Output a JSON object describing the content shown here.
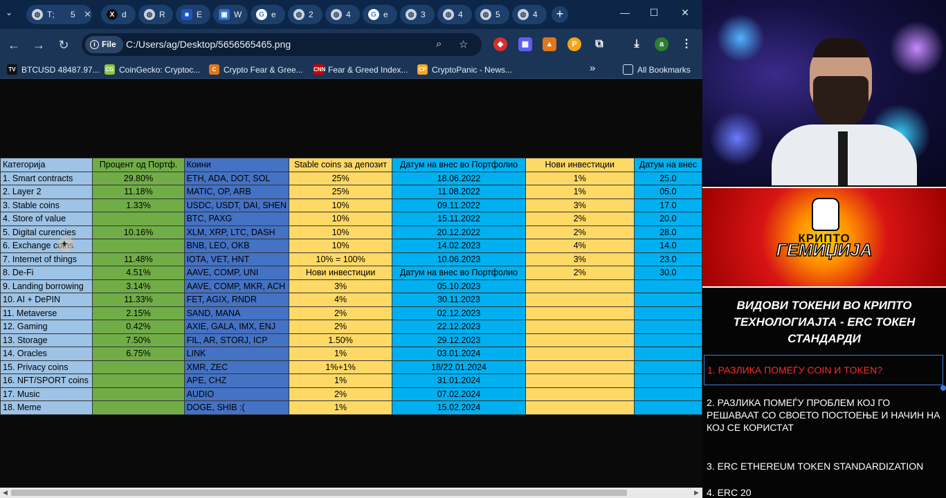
{
  "tabs": [
    {
      "icon": "globe",
      "label": "Т;"
    },
    {
      "icon": "none",
      "label": "5"
    },
    {
      "icon": "x",
      "label": "d"
    },
    {
      "icon": "globe",
      "label": "R"
    },
    {
      "icon": "cube",
      "label": "E"
    },
    {
      "icon": "box",
      "label": "W"
    },
    {
      "icon": "google",
      "label": "e"
    },
    {
      "icon": "globe",
      "label": "2"
    },
    {
      "icon": "globe",
      "label": "4"
    },
    {
      "icon": "google",
      "label": "e"
    },
    {
      "icon": "globe",
      "label": "3"
    },
    {
      "icon": "globe",
      "label": "4"
    },
    {
      "icon": "globe",
      "label": "5"
    },
    {
      "icon": "globe",
      "label": "4"
    }
  ],
  "newtab_label": "+",
  "window_controls": {
    "minimize": "—",
    "maximize": "☐",
    "close": "✕"
  },
  "nav": {
    "back": "←",
    "forward": "→",
    "reload": "↻"
  },
  "address": {
    "chip_label": "File",
    "url": "C:/Users/ag/Desktop/5656565465.png"
  },
  "bookmarks": [
    {
      "label": "BTCUSD 48487.97...",
      "icon_color": "#111111",
      "icon_text": "TV"
    },
    {
      "label": "CoinGecko: Cryptoc...",
      "icon_color": "#8dc63f",
      "icon_text": "CG"
    },
    {
      "label": "Crypto Fear & Gree...",
      "icon_color": "#e2761b",
      "icon_text": "C"
    },
    {
      "label": "Fear & Greed Index...",
      "icon_color": "#cc0000",
      "icon_text": "CNN"
    },
    {
      "label": "CryptoPanic - News...",
      "icon_color": "#f5a623",
      "icon_text": "CP"
    }
  ],
  "bookmarks_overflow": "»",
  "all_bookmarks": "All Bookmarks",
  "sheet": {
    "headers": [
      "Категорија",
      "Процент од Портф.",
      "Коини",
      "Stable coins за депозит",
      "Датум на внес во Портфолио",
      "Нови инвестиции",
      "Датум на внес"
    ],
    "rows": [
      [
        "1. Smart contracts",
        "29.80%",
        "ETH, ADA, DOT, SOL",
        "25%",
        "18.06.2022",
        "1%",
        "25.0"
      ],
      [
        "2. Layer 2",
        "11.18%",
        "MATIC, OP, ARB",
        "25%",
        "11.08.2022",
        "1%",
        "05.0"
      ],
      [
        "3. Stable coins",
        "1.33%",
        "USDC, USDT, DAI, SHEN",
        "10%",
        "09.11.2022",
        "3%",
        "17.0"
      ],
      [
        "4. Store of value",
        "",
        "BTC, PAXG",
        "10%",
        "15.11.2022",
        "2%",
        "20.0"
      ],
      [
        "5. Digital curencies",
        "10.16%",
        "XLM, XRP, LTC, DASH",
        "10%",
        "20.12.2022",
        "2%",
        "28.0"
      ],
      [
        "6. Exchange coins",
        "",
        "BNB, LEO, OKB",
        "10%",
        "14.02.2023",
        "4%",
        "14.0"
      ],
      [
        "7. Internet of things",
        "11.48%",
        "IOTA, VET, HNT",
        "10% = 100%",
        "10.06.2023",
        "3%",
        "23.0"
      ],
      [
        "8. De-Fi",
        "4.51%",
        "AAVE, COMP, UNI",
        "Нови инвестиции",
        "Датум на внес во Портфолио",
        "2%",
        "30.0"
      ],
      [
        "9. Landing borrowing",
        "3.14%",
        "AAVE, COMP, MKR, ACH",
        "3%",
        "05.10.2023",
        "",
        ""
      ],
      [
        "10. AI + DePIN",
        "11.33%",
        "FET, AGIX, RNDR",
        "4%",
        "30.11.2023",
        "",
        ""
      ],
      [
        "11. Metaverse",
        "2.15%",
        "SAND, MANA",
        "2%",
        "02.12.2023",
        "",
        ""
      ],
      [
        "12. Gaming",
        "0.42%",
        "AXIE, GALA, IMX, ENJ",
        "2%",
        "22.12.2023",
        "",
        ""
      ],
      [
        "13. Storage",
        "7.50%",
        "FIL, AR, STORJ, ICP",
        "1.50%",
        "29.12.2023",
        "",
        ""
      ],
      [
        "14. Oracles",
        "6.75%",
        "LINK",
        "1%",
        "03.01.2024",
        "",
        ""
      ],
      [
        "15. Privacy coins",
        "",
        "XMR, ZEC",
        "1%+1%",
        "18/22.01.2024",
        "",
        ""
      ],
      [
        "16. NFT/SPORT coins",
        "",
        "APE, CHZ",
        "1%",
        "31.01.2024",
        "",
        ""
      ],
      [
        "17. Music",
        "",
        "AUDIO",
        "2%",
        "07.02.2024",
        "",
        ""
      ],
      [
        "18. Meme",
        "",
        "DOGE, SHIB :(",
        "1%",
        "15.02.2024",
        "",
        ""
      ]
    ]
  },
  "panel": {
    "logo_line1": "КРИПТО",
    "logo_line2": "ГЕМИЏИЈА",
    "title": "ВИДОВИ ТОКЕНИ ВО КРИПТО ТЕХНОЛОГИАЈТА - ERC ТОКЕН СТАНДАРДИ",
    "topics": [
      "1. РАЗЛИКА ПОМЕЃУ COIN И TOKEN?",
      "2. РАЗЛИКА ПОМЕЃУ ПРОБЛЕМ КОЈ ГО РЕШАВААТ СО СВОЕТО ПОСТОЕЊЕ И НАЧИН НА КОЈ СЕ КОРИСТАТ",
      "3. ERC ETHEREUM TOKEN STANDARDIZATION",
      "4. ERC 20"
    ]
  }
}
